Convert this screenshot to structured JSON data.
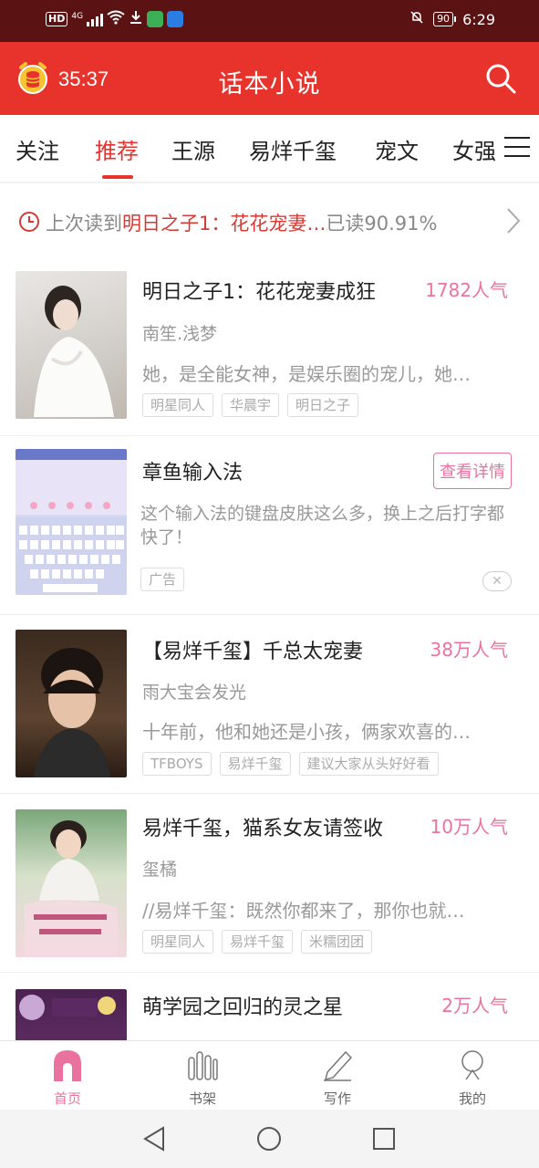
{
  "status_bar": {
    "hd": "HD",
    "network": "4G",
    "time": "6:29",
    "battery": "90",
    "icons": [
      "signal-icon",
      "wifi-icon",
      "download-icon",
      "notification-mute-icon"
    ]
  },
  "header": {
    "timer": "35:37",
    "title": "话本小说",
    "icons": [
      "coin-timer-icon",
      "search-icon"
    ]
  },
  "tabs": [
    {
      "label": "关注",
      "active": false
    },
    {
      "label": "推荐",
      "active": true
    },
    {
      "label": "王源",
      "active": false
    },
    {
      "label": "易烊千玺",
      "active": false
    },
    {
      "label": "宠文",
      "active": false
    },
    {
      "label": "女强",
      "active": false
    }
  ],
  "last_read": {
    "prefix": "上次读到",
    "book": "明日之子1：花花宠妻…",
    "progress": "已读90.91%"
  },
  "books": [
    {
      "title": "明日之子1：花花宠妻成狂",
      "popularity": "1782人气",
      "author": "南笙.浅梦",
      "desc": "她，是全能女神，是娱乐圈的宠儿，她…",
      "tags": [
        "明星同人",
        "华晨宇",
        "明日之子"
      ]
    },
    {
      "title": "【易烊千玺】千总太宠妻",
      "popularity": "38万人气",
      "author": "雨大宝会发光",
      "desc": "十年前，他和她还是小孩，俩家欢喜的…",
      "tags": [
        "TFBOYS",
        "易烊千玺",
        "建议大家从头好好看"
      ]
    },
    {
      "title": "易烊千玺，猫系女友请签收",
      "popularity": "10万人气",
      "author": "玺橘",
      "desc": "//易烊千玺：既然你都来了，那你也就…",
      "tags": [
        "明星同人",
        "易烊千玺",
        "米糯团团"
      ]
    },
    {
      "title": "萌学园之回归的灵之星",
      "popularity": "2万人气"
    }
  ],
  "ad": {
    "title": "章鱼输入法",
    "button": "查看详情",
    "desc": "这个输入法的键盘皮肤这么多，换上之后打字都快了！",
    "tag": "广告",
    "close": "✕"
  },
  "bottom_nav": [
    {
      "label": "首页",
      "active": true
    },
    {
      "label": "书架",
      "active": false
    },
    {
      "label": "写作",
      "active": false
    },
    {
      "label": "我的",
      "active": false
    }
  ],
  "colors": {
    "brand_red": "#e8332d",
    "accent_pink": "#e9739e",
    "status_bar": "#5a1212"
  }
}
